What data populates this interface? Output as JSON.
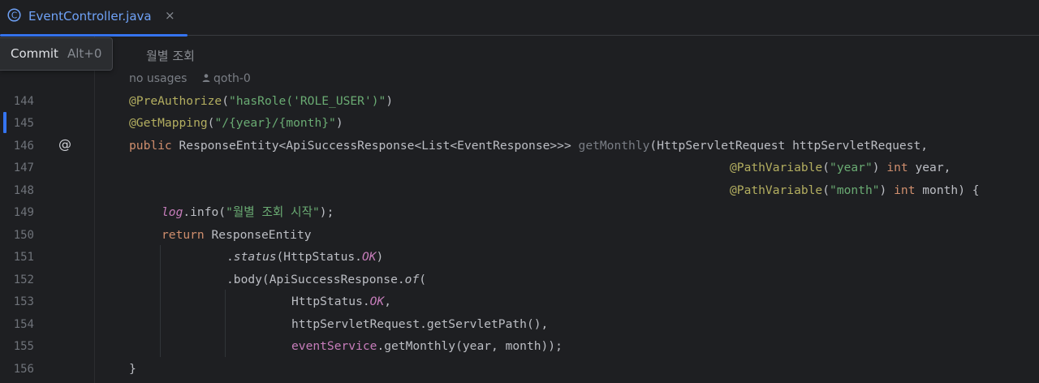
{
  "tab": {
    "title": "EventController.java",
    "icon": "class-c-icon",
    "close_glyph": "×",
    "accent": "#3574f0"
  },
  "tooltip": {
    "label": "Commit",
    "shortcut": "Alt+0"
  },
  "comment": "월별 조회",
  "inlay": {
    "usages": "no usages",
    "author": "qoth-0"
  },
  "gutter": {
    "line_numbers": [
      "144",
      "145",
      "146",
      "147",
      "148",
      "149",
      "150",
      "151",
      "152",
      "153",
      "154",
      "155",
      "156"
    ],
    "annotation_marker": "@"
  },
  "code": {
    "l144": {
      "ann": "@PreAuthorize",
      "open": "(",
      "str": "\"hasRole('ROLE_USER')\"",
      "close": ")"
    },
    "l145": {
      "ann": "@GetMapping",
      "open": "(",
      "str": "\"/{year}/{month}\"",
      "close": ")"
    },
    "l146": {
      "kw": "public",
      "type": " ResponseEntity<ApiSuccessResponse<List<EventResponse>>> ",
      "method": "getMonthly",
      "params": "(HttpServletRequest httpServletRequest,"
    },
    "l147": {
      "ann": "@PathVariable",
      "open": "(",
      "str": "\"year\"",
      "close": ") ",
      "kw": "int",
      "rest": " year,"
    },
    "l148": {
      "ann": "@PathVariable",
      "open": "(",
      "str": "\"month\"",
      "close": ") ",
      "kw": "int",
      "rest": " month) {"
    },
    "l149": {
      "field": "log",
      "call": ".info(",
      "str": "\"월별 조회 시작\"",
      "end": ");"
    },
    "l150": {
      "kw": "return",
      "rest": " ResponseEntity"
    },
    "l151": {
      "dot": ".",
      "method": "status",
      "open": "(HttpStatus.",
      "const": "OK",
      "close": ")"
    },
    "l152": {
      "call": ".body(ApiSuccessResponse.",
      "method": "of",
      "open": "("
    },
    "l153": {
      "pre": "HttpStatus.",
      "const": "OK",
      "end": ","
    },
    "l154": {
      "text": "httpServletRequest.getServletPath(),"
    },
    "l155": {
      "field": "eventService",
      "rest": ".getMonthly(year, month));"
    },
    "l156": {
      "text": "}"
    }
  }
}
